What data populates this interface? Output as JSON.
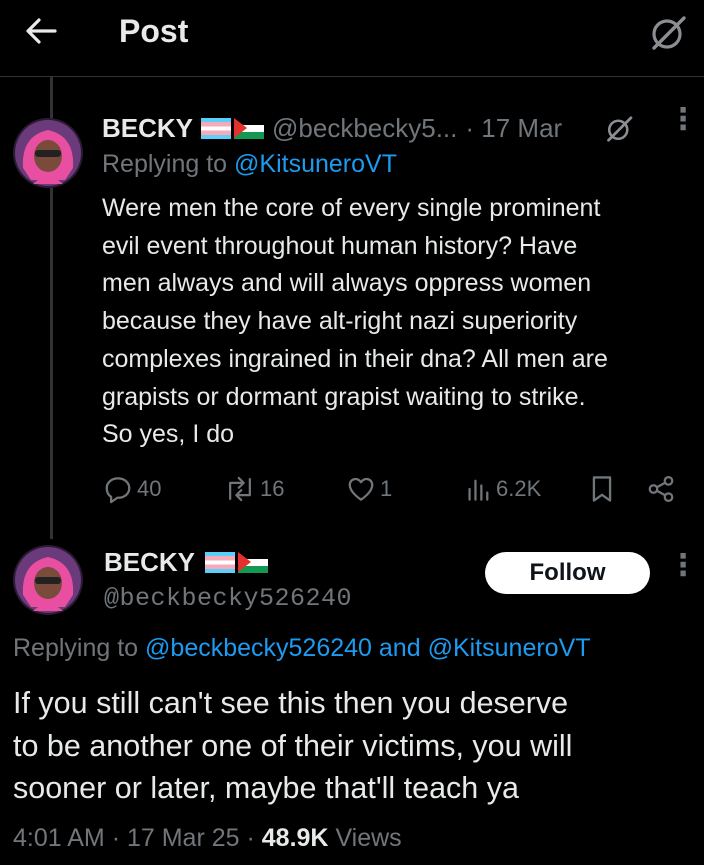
{
  "header": {
    "title": "Post"
  },
  "reply_tweet": {
    "name": "BECKY",
    "handle": "@beckbecky5...",
    "date": "· 17 Mar",
    "replying_prefix": "Replying to",
    "replying_to": "@KitsuneroVT",
    "lines": [
      "Were men the core of every single prominent",
      "evil event throughout human history? Have",
      "men always and will always oppress women",
      "because they have alt-right nazi superiority",
      "complexes ingrained in their dna? All men are",
      "grapists or dormant grapist waiting to strike.",
      "So yes, I do"
    ],
    "actions": {
      "replies": "40",
      "reposts": "16",
      "likes": "1",
      "views": "6.2K"
    }
  },
  "main_tweet": {
    "name": "BECKY",
    "handle": "@beckbecky526240",
    "follow_label": "Follow",
    "replying_prefix": "Replying to",
    "replying_to_1": "@beckbecky526240",
    "replying_and": "and",
    "replying_to_2": "@KitsuneroVT",
    "lines": [
      "If you still can't see this then you deserve",
      "to be another one of their victims, you will",
      "sooner or later, maybe that'll teach ya"
    ],
    "time": "4:01 AM",
    "sep": "·",
    "date": "17 Mar 25",
    "views_count": "48.9K",
    "views_label": "Views"
  },
  "colors": {
    "background": "#000000",
    "text": "#e7e9ea",
    "muted": "#71767b",
    "link": "#1d9bf0",
    "divider": "#2f3336"
  },
  "icons": [
    "back-arrow-icon",
    "grok-icon",
    "more-icon",
    "reply-icon",
    "repost-icon",
    "like-icon",
    "views-icon",
    "bookmark-icon",
    "share-icon"
  ]
}
